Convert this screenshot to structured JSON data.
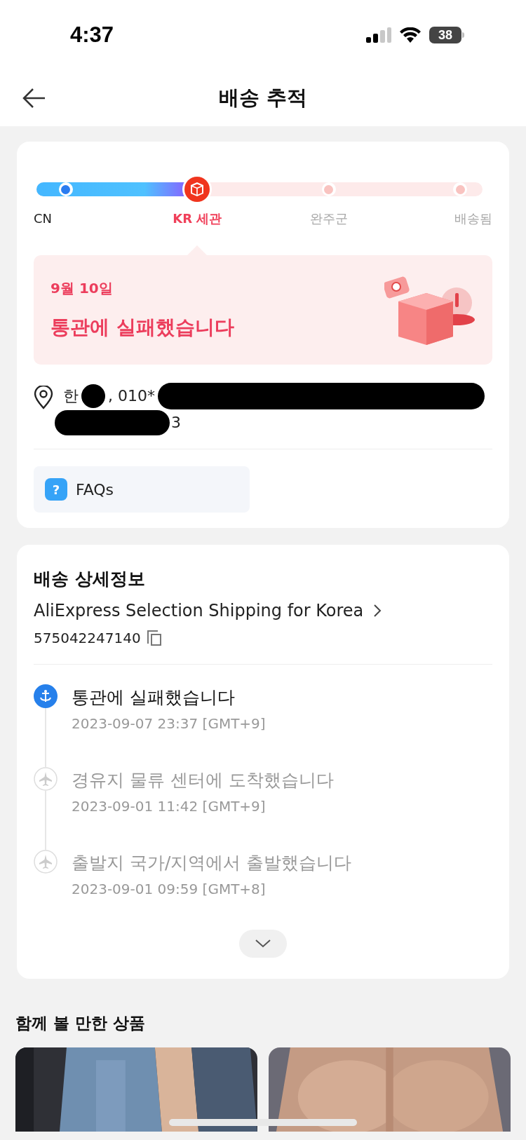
{
  "status_bar": {
    "time": "4:37",
    "battery": "38"
  },
  "header": {
    "title": "배송 추적"
  },
  "progress": {
    "stages": [
      {
        "label": "CN",
        "reached": true,
        "current": false
      },
      {
        "label": "KR 세관",
        "reached": true,
        "current": true
      },
      {
        "label": "완주군",
        "reached": false,
        "current": false
      },
      {
        "label": "배송됨",
        "reached": false,
        "current": false
      }
    ]
  },
  "notice": {
    "date": "9월 10일",
    "message": "통관에 실패했습니다"
  },
  "address": {
    "part_1": "한",
    "part_2": ", 010*",
    "part_3": "3"
  },
  "faq": {
    "label": "FAQs",
    "icon": "?"
  },
  "details": {
    "title": "배송 상세정보",
    "carrier": "AliExpress Selection Shipping for Korea",
    "tracking_number": "575042247140",
    "events": [
      {
        "text": "통관에 실패했습니다",
        "time": "2023-09-07 23:37 [GMT+9]",
        "active": true
      },
      {
        "text": "경유지 물류 센터에 도착했습니다",
        "time": "2023-09-01 11:42 [GMT+9]",
        "active": false
      },
      {
        "text": "출발지 국가/지역에서 출발했습니다",
        "time": "2023-09-01 09:59 [GMT+8]",
        "active": false
      }
    ]
  },
  "recommendations": {
    "title": "함께 볼 만한 상품"
  }
}
